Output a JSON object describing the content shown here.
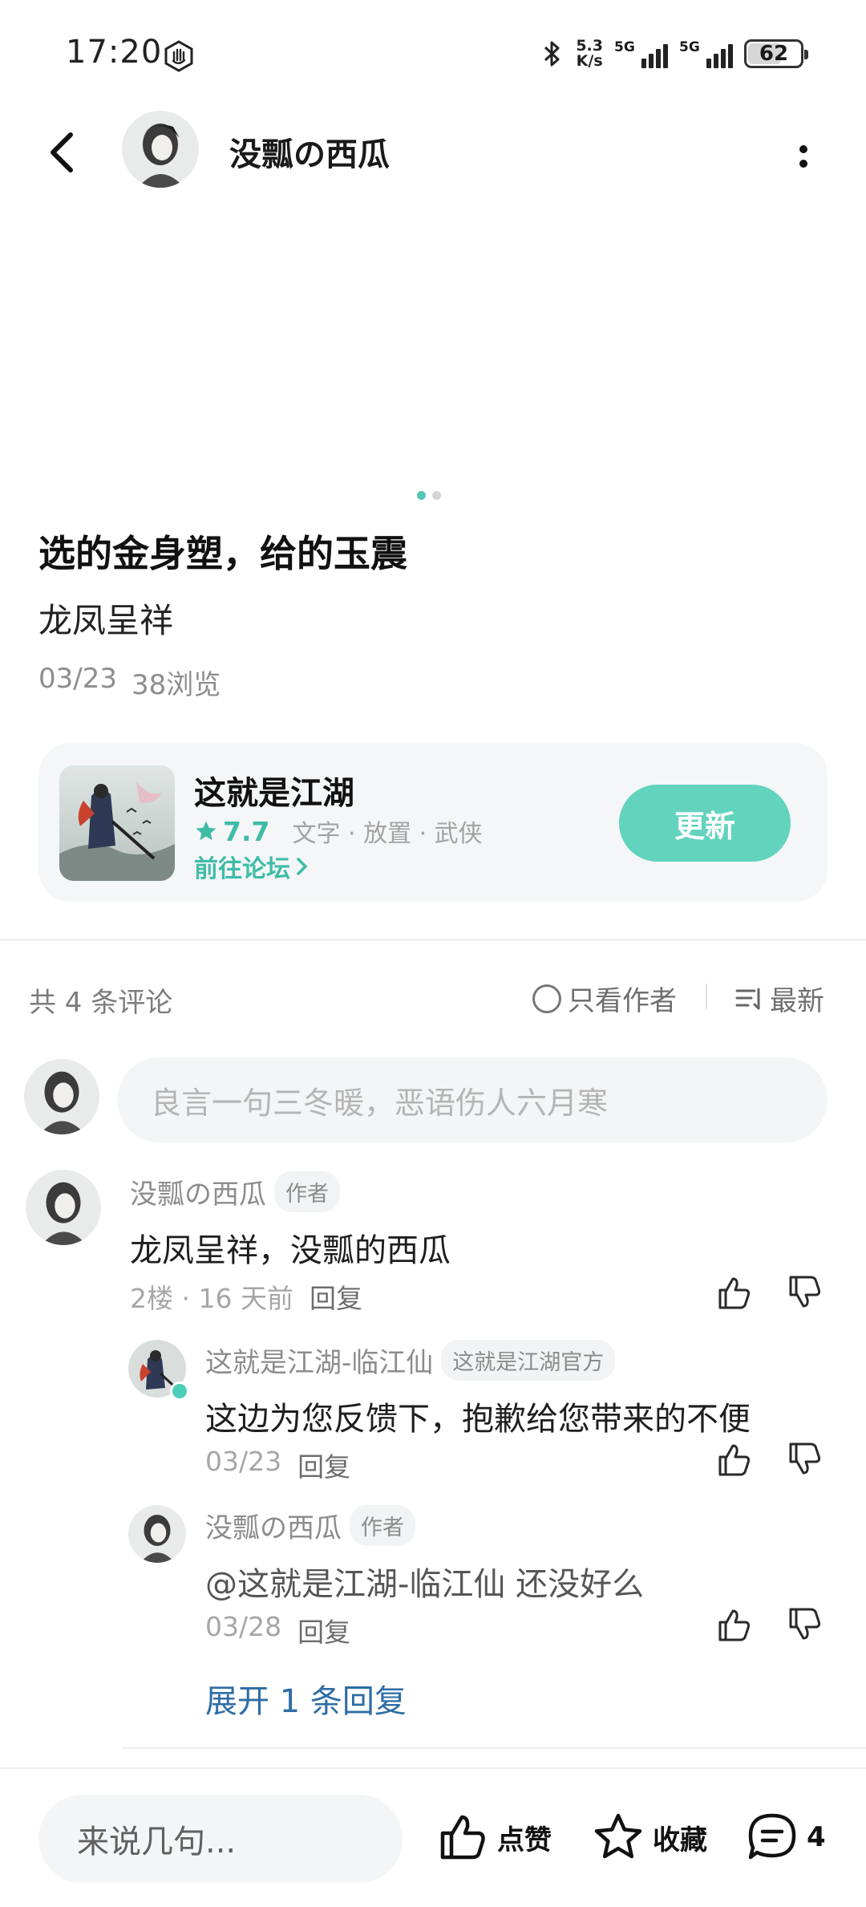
{
  "status_bar": {
    "time": "17:20",
    "net_speed_top": "5.3",
    "net_speed_bottom": "K/s",
    "sim1": "5G",
    "sim2": "5G",
    "battery": "62"
  },
  "header": {
    "title": "没瓢の西瓜"
  },
  "post": {
    "title": "选的金身塑，给的玉震",
    "body": "龙凤呈祥",
    "date": "03/23",
    "views": "38浏览"
  },
  "game": {
    "name": "这就是江湖",
    "score": "7.7",
    "tags": "文字 · 放置 · 武侠",
    "forum_link": "前往论坛",
    "button": "更新"
  },
  "comments_header": {
    "count": "共 4 条评论",
    "author_only": "只看作者",
    "sort": "最新"
  },
  "comment_input": {
    "placeholder": "良言一句三冬暖，恶语伤人六月寒"
  },
  "comments": [
    {
      "user": "没瓢の西瓜",
      "tag": "作者",
      "text": "龙凤呈祥，没瓢的西瓜",
      "meta": "2楼 · 16 天前",
      "reply": "回复"
    },
    {
      "user": "这就是江湖-临江仙",
      "tag": "这就是江湖官方",
      "text": "这边为您反馈下，抱歉给您带来的不便",
      "meta": "03/23",
      "reply": "回复"
    },
    {
      "user": "没瓢の西瓜",
      "tag": "作者",
      "text": "@这就是江湖-临江仙  还没好么",
      "meta": "03/28",
      "reply": "回复"
    }
  ],
  "expand_replies": "展开 1 条回复",
  "bottom_bar": {
    "input_placeholder": "来说几句...",
    "like": "点赞",
    "favorite": "收藏",
    "comment_count": "4"
  },
  "colors": {
    "accent": "#62d3bd",
    "accent_text": "#3fbca6",
    "link_blue": "#2e6da4"
  }
}
